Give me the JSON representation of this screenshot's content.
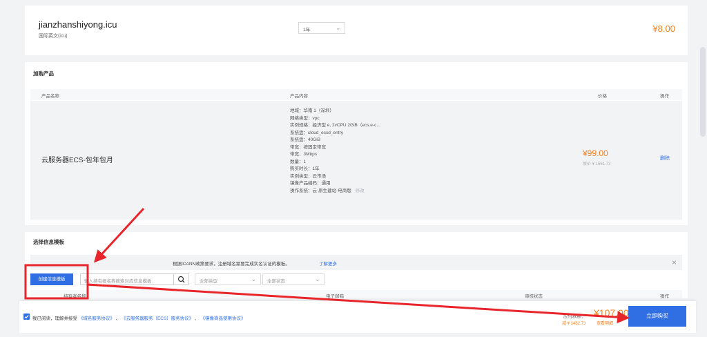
{
  "domain_item": {
    "name": "jianzhanshiyong.icu",
    "sub": "国际英文(icu)",
    "duration": "1年",
    "price": "¥8.00"
  },
  "addon_section": {
    "title": "加购产品",
    "col_product": "产品名称",
    "col_content": "产品内容",
    "col_price": "价格",
    "col_action": "操作",
    "row": {
      "name": "云服务器ECS-包年包月",
      "details": [
        "地域：华南 1（深圳）",
        "网络类型：vpc",
        "实例规格：经济型 e, 2vCPU 2GiB（ecs.e-c...",
        "系统盘：cloud_essd_entry",
        "系统盘：40GiB",
        "带宽：按固定带宽",
        "带宽：3Mbps",
        "数量：1",
        "购买时长：1年",
        "实例类型：云市场",
        "镜像产品编码：通用",
        "操作系统：云·原生建站·电商版"
      ],
      "os_edit": "修改",
      "price": "¥99.00",
      "orig_price": "原价 ¥ 1561.73",
      "action": "删除"
    }
  },
  "template_section": {
    "title": "选择信息模板",
    "notice_prefix": "根据ICANN政策要求，注册域名需要完成实名认证的模板。",
    "notice_link": "了解更多",
    "close": "×",
    "create_button": "创建信息模板",
    "search_placeholder": "输入持有者名称搜索对应信息模板",
    "type_dropdown": "全部类型",
    "status_dropdown": "全部状态",
    "col_holder": "持有者名称",
    "col_email": "电子邮箱",
    "col_status": "审核状态",
    "col_op": "操作"
  },
  "footer": {
    "agree_prefix": "我已阅读，理解并接受",
    "terms": [
      "《域名服务协议》",
      "《云服务器服务（ECS）服务协议》",
      "《镜像商品使用协议》"
    ],
    "sep1": "、",
    "sep2": "、",
    "total_label": "应付款额：",
    "total": "¥107.00",
    "saved": "减 ¥ 1462.73",
    "detail_link": "查看明细",
    "buy_button": "立即购买"
  },
  "colors": {
    "accent_blue": "#2f6ee3",
    "orange": "#f4811f",
    "annotation_red": "#e8252a"
  }
}
